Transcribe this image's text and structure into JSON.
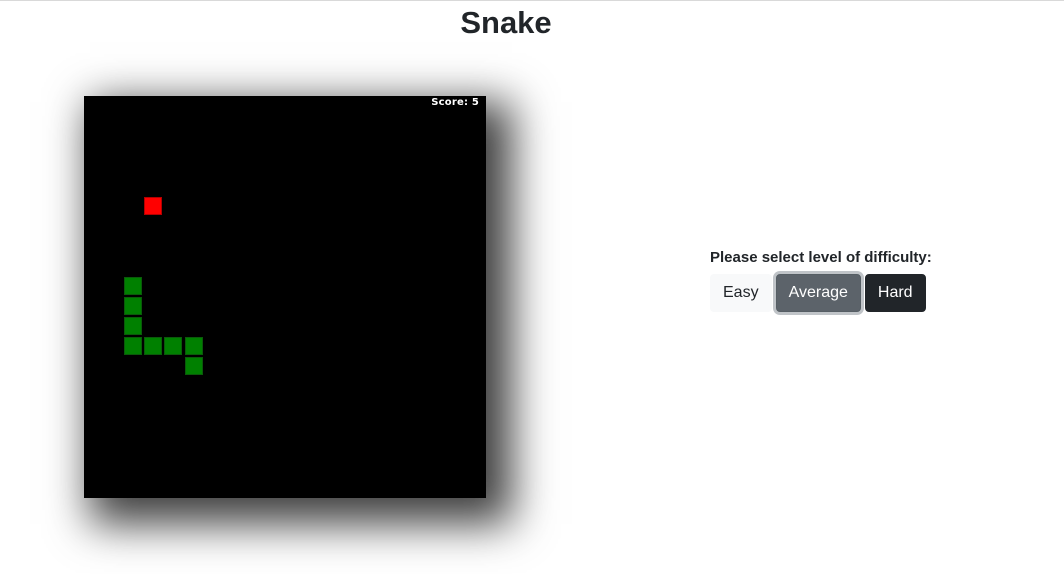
{
  "page": {
    "title": "Snake"
  },
  "game": {
    "score_label": "Score: 5",
    "score": 5,
    "grid_cols": 20,
    "grid_rows": 20,
    "food": {
      "col": 3,
      "row": 5
    },
    "snake": [
      {
        "col": 5,
        "row": 13
      },
      {
        "col": 5,
        "row": 12
      },
      {
        "col": 4,
        "row": 12
      },
      {
        "col": 3,
        "row": 12
      },
      {
        "col": 2,
        "row": 12
      },
      {
        "col": 2,
        "row": 11
      },
      {
        "col": 2,
        "row": 10
      },
      {
        "col": 2,
        "row": 9
      }
    ],
    "colors": {
      "board": "#000000",
      "snake": "#008000",
      "food": "#ff0000"
    }
  },
  "difficulty": {
    "prompt": "Please select level of difficulty:",
    "options": [
      "Easy",
      "Average",
      "Hard"
    ],
    "selected": "Average"
  }
}
